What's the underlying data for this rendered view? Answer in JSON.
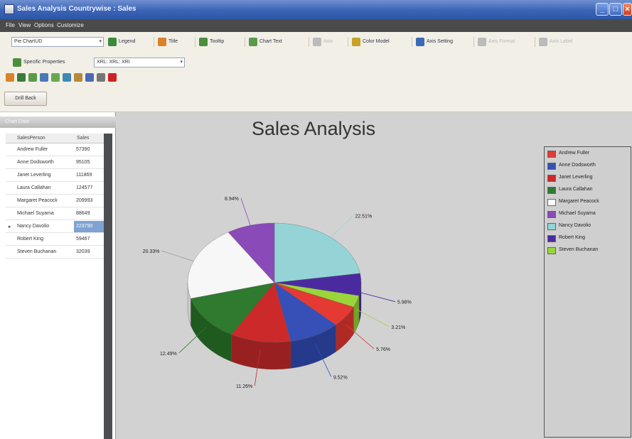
{
  "window": {
    "title": "Sales Analysis Countrywise : Sales"
  },
  "menu": [
    "File",
    "View",
    "Options",
    "Customize"
  ],
  "toolbar": {
    "chart_type": "Pie ChartUD",
    "row1_tools": [
      {
        "label": "Legend",
        "icon": "legend-icon",
        "color": "#3a8a3a",
        "enabled": true
      },
      {
        "label": "Title",
        "icon": "title-icon",
        "color": "#d9822b",
        "enabled": true
      },
      {
        "label": "Tooltip",
        "icon": "tooltip-icon",
        "color": "#4a8f3c",
        "enabled": true
      },
      {
        "label": "Chart Text",
        "icon": "chart-text-icon",
        "color": "#5a9a4a",
        "enabled": true
      },
      {
        "label": "Axis",
        "icon": "axis-icon",
        "color": "#bbbbbb",
        "enabled": false
      },
      {
        "label": "Color Model",
        "icon": "color-model-icon",
        "color": "#c9a227",
        "enabled": true
      },
      {
        "label": "Axis Setting",
        "icon": "axis-setting-icon",
        "color": "#3c6bb5",
        "enabled": true
      },
      {
        "label": "Axis Format",
        "icon": "axis-format-icon",
        "color": "#bbbbbb",
        "enabled": false
      },
      {
        "label": "Axis Label",
        "icon": "axis-label-icon",
        "color": "#bbbbbb",
        "enabled": false
      }
    ],
    "specific_properties": "Specific Properties",
    "size_combo": "XRL: XRL: XRI",
    "quick_icons": [
      {
        "name": "open-icon",
        "color": "#d9822b"
      },
      {
        "name": "save-icon",
        "color": "#3c7a3c"
      },
      {
        "name": "export-icon",
        "color": "#5a9a4a"
      },
      {
        "name": "undo-icon",
        "color": "#4a7ab5"
      },
      {
        "name": "chart-wizard-icon",
        "color": "#6aa84f"
      },
      {
        "name": "drill-icon",
        "color": "#3c8ab5"
      },
      {
        "name": "paint-icon",
        "color": "#b58a3c"
      },
      {
        "name": "grid-icon",
        "color": "#4a6ab5"
      },
      {
        "name": "print-icon",
        "color": "#777777"
      },
      {
        "name": "help-icon",
        "color": "#cc2222"
      }
    ],
    "unit_button": "Drill Back"
  },
  "left_panel": {
    "title": "Chart Data",
    "columns": [
      "SalesPerson",
      "Sales"
    ],
    "rows": [
      {
        "name": "Andrew Fuller",
        "value": "57390"
      },
      {
        "name": "Anne Dodsworth",
        "value": "95105"
      },
      {
        "name": "Janet Leverling",
        "value": "111869"
      },
      {
        "name": "Laura Callahan",
        "value": "124577"
      },
      {
        "name": "Margaret Peacock",
        "value": "209993"
      },
      {
        "name": "Michael Suyama",
        "value": "88649"
      },
      {
        "name": "Nancy Davolio",
        "value": "223790",
        "selected": true
      },
      {
        "name": "Robert King",
        "value": "59467"
      },
      {
        "name": "Steven Buchanan",
        "value": "32039"
      }
    ]
  },
  "chart_data": {
    "type": "pie",
    "title": "Sales Analysis",
    "legend_position": "right",
    "slices": [
      {
        "name": "Nancy Davolio",
        "value": 22.51,
        "label": "22.51%",
        "color": "#94d4d6",
        "side": "#6fa9ab"
      },
      {
        "name": "Robert King",
        "value": 5.98,
        "label": "5.98%",
        "color": "#4b2aa0",
        "side": "#35207a"
      },
      {
        "name": "Steven Buchanan",
        "value": 3.21,
        "label": "3.21%",
        "color": "#9ad63a",
        "side": "#72a22a"
      },
      {
        "name": "Andrew Fuller",
        "value": 5.76,
        "label": "5.76%",
        "color": "#e53a33",
        "side": "#b02a25"
      },
      {
        "name": "Anne Dodsworth",
        "value": 9.52,
        "label": "9.52%",
        "color": "#3650b8",
        "side": "#253a8a"
      },
      {
        "name": "Janet Leverling",
        "value": 11.26,
        "label": "11.26%",
        "color": "#cc2a2a",
        "side": "#992020"
      },
      {
        "name": "Laura Callahan",
        "value": 12.49,
        "label": "12.49%",
        "color": "#2e7a2e",
        "side": "#1f5a1f"
      },
      {
        "name": "Margaret Peacock",
        "value": 20.33,
        "label": "20.33%",
        "color": "#f7f7f7",
        "side": "#c8c8c8"
      },
      {
        "name": "Michael Suyama",
        "value": 8.94,
        "label": "8.94%",
        "color": "#8a4ab8",
        "side": "#663690"
      }
    ],
    "legend": [
      {
        "name": "Andrew Fuller",
        "color": "#e53a33"
      },
      {
        "name": "Anne Dodsworth",
        "color": "#3650b8"
      },
      {
        "name": "Janet Leverling",
        "color": "#cc2a2a"
      },
      {
        "name": "Laura Callahan",
        "color": "#2e7a2e"
      },
      {
        "name": "Margaret Peacock",
        "color": "#ffffff"
      },
      {
        "name": "Michael Suyama",
        "color": "#8a4ab8"
      },
      {
        "name": "Nancy Davolio",
        "color": "#94d4d6"
      },
      {
        "name": "Robert King",
        "color": "#4b2aa0"
      },
      {
        "name": "Steven Buchanan",
        "color": "#9ad63a"
      }
    ]
  }
}
